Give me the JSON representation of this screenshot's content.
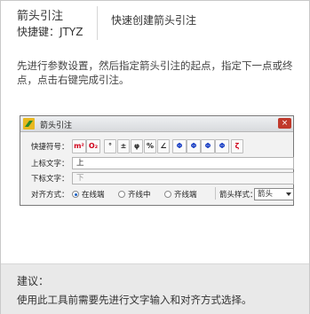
{
  "header": {
    "command_name": "箭头引注",
    "shortcut": "快捷键：JTYZ",
    "description": "快速创建箭头引注"
  },
  "instruction": "先进行参数设置，然后指定箭头引注的起点，指定下一点或终点，点击右键完成引注。",
  "dialog": {
    "title": "箭头引注",
    "close_label": "×",
    "symbols_label": "快捷符号：",
    "symbols": [
      {
        "text": "m²",
        "color": "red"
      },
      {
        "text": "O₂",
        "color": "red"
      },
      {
        "text": "°",
        "color": "dark"
      },
      {
        "text": "±",
        "color": "dark"
      },
      {
        "text": "φ",
        "color": "dark"
      },
      {
        "text": "%",
        "color": "dark"
      },
      {
        "text": "∠",
        "color": "dark"
      },
      {
        "text": "Φ",
        "color": "blue"
      },
      {
        "text": "Φ",
        "color": "blue"
      },
      {
        "text": "Φ",
        "color": "blue"
      },
      {
        "text": "Φ",
        "color": "blue"
      },
      {
        "text": "ζ",
        "color": "red"
      }
    ],
    "upper_text_label": "上标文字：",
    "upper_text_value": "上",
    "lower_text_label": "下标文字：",
    "lower_text_value": "下",
    "align_label": "对齐方式：",
    "align_options": [
      "在线端",
      "齐线中",
      "齐线端"
    ],
    "align_selected": 0,
    "arrow_style_label": "箭头样式：",
    "arrow_style_value": "箭头"
  },
  "tips": {
    "title": "建议：",
    "text": "使用此工具前需要先进行文字输入和对齐方式选择。"
  },
  "colors": {
    "symbol_red": "#d0021b",
    "symbol_blue": "#1a3fc4",
    "tips_background": "#e9e9e9"
  }
}
